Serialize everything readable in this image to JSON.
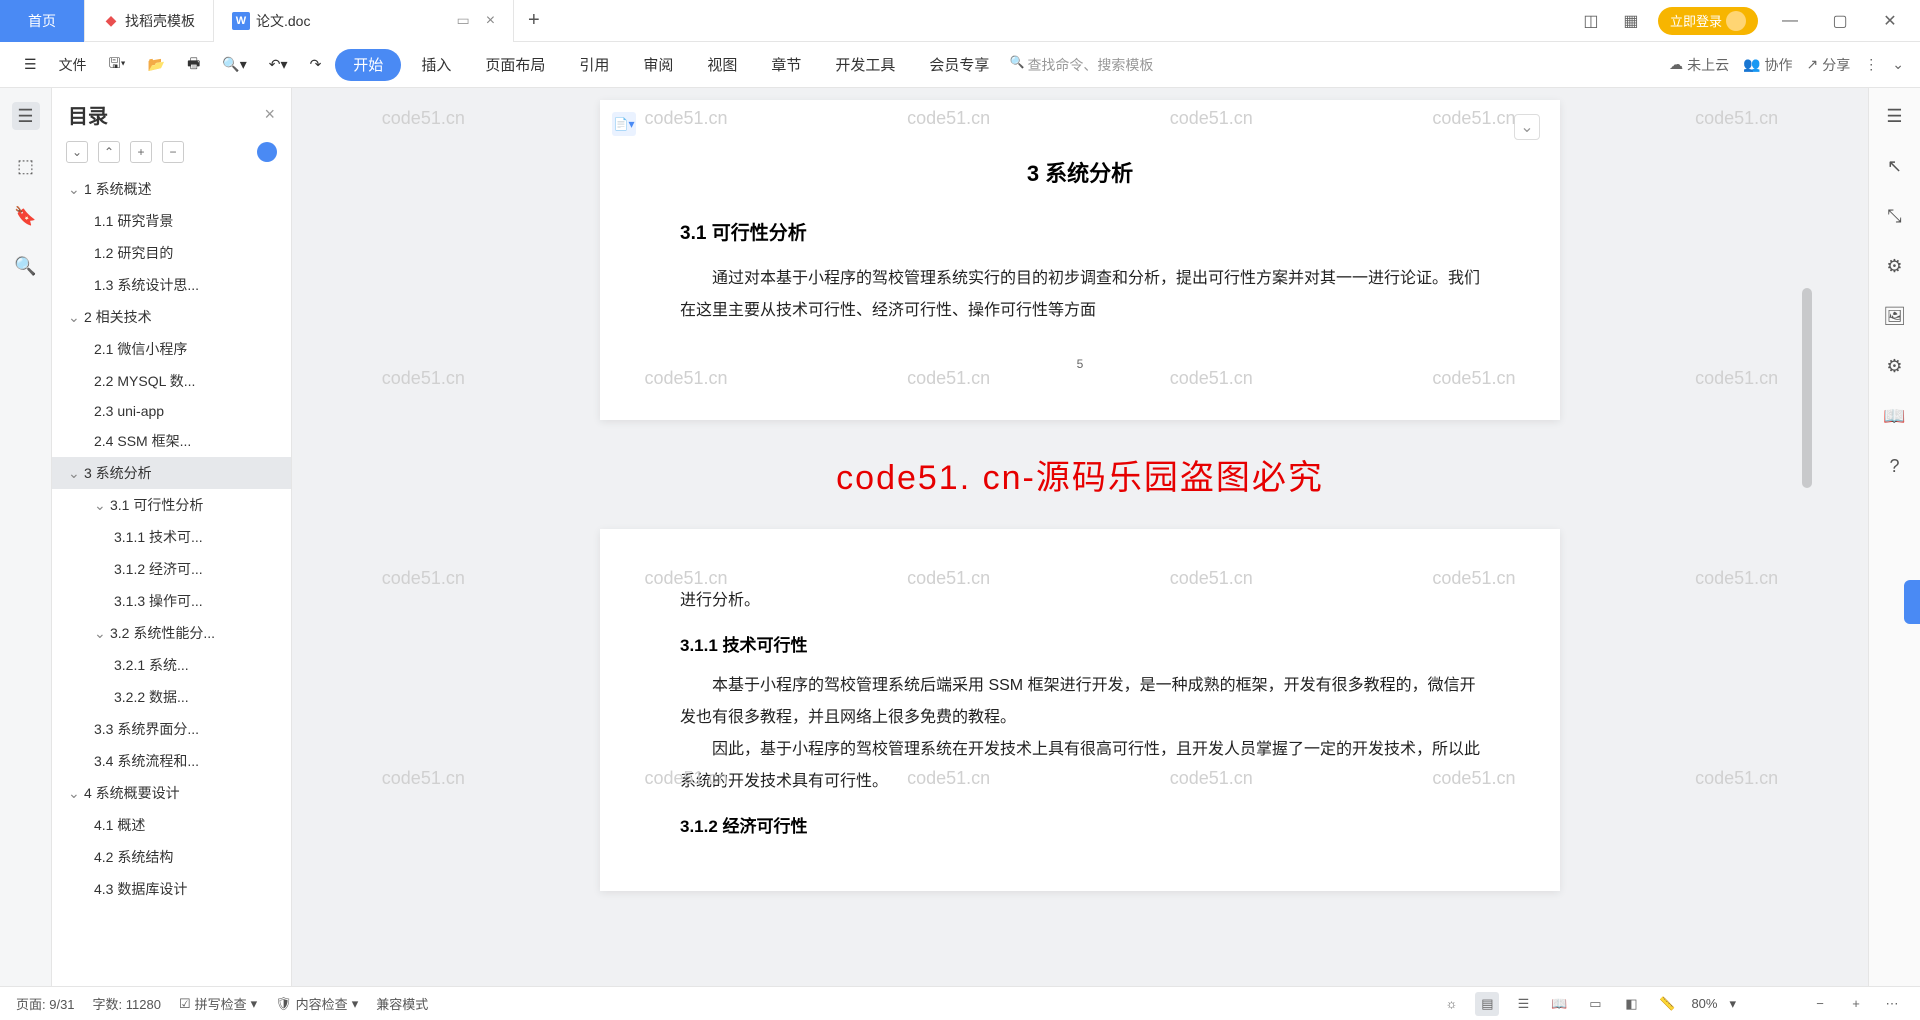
{
  "titlebar": {
    "home_tab": "首页",
    "tab1": {
      "label": "找稻壳模板"
    },
    "tab2": {
      "label": "论文.doc"
    },
    "login": "立即登录"
  },
  "toolbar": {
    "file": "文件",
    "menu": [
      "开始",
      "插入",
      "页面布局",
      "引用",
      "审阅",
      "视图",
      "章节",
      "开发工具",
      "会员专享"
    ],
    "search_placeholder": "查找命令、搜索模板",
    "cloud": "未上云",
    "coop": "协作",
    "share": "分享"
  },
  "outline": {
    "title": "目录",
    "items": [
      {
        "lv": 1,
        "exp": true,
        "label": "1 系统概述"
      },
      {
        "lv": 2,
        "label": "1.1 研究背景"
      },
      {
        "lv": 2,
        "label": "1.2 研究目的"
      },
      {
        "lv": 2,
        "label": "1.3 系统设计思..."
      },
      {
        "lv": 1,
        "exp": true,
        "label": "2 相关技术"
      },
      {
        "lv": 2,
        "label": "2.1 微信小程序"
      },
      {
        "lv": 2,
        "label": "2.2 MYSQL 数..."
      },
      {
        "lv": 2,
        "label": "2.3 uni-app"
      },
      {
        "lv": 2,
        "label": "2.4 SSM 框架..."
      },
      {
        "lv": 1,
        "exp": true,
        "label": "3 系统分析",
        "sel": true
      },
      {
        "lv": 2,
        "exp": true,
        "label": "3.1 可行性分析"
      },
      {
        "lv": 3,
        "label": "3.1.1 技术可..."
      },
      {
        "lv": 3,
        "label": "3.1.2 经济可..."
      },
      {
        "lv": 3,
        "label": "3.1.3 操作可..."
      },
      {
        "lv": 2,
        "exp": true,
        "label": "3.2 系统性能分..."
      },
      {
        "lv": 3,
        "label": "3.2.1 系统..."
      },
      {
        "lv": 3,
        "label": "3.2.2 数据..."
      },
      {
        "lv": 2,
        "label": "3.3 系统界面分..."
      },
      {
        "lv": 2,
        "label": "3.4 系统流程和..."
      },
      {
        "lv": 1,
        "exp": true,
        "label": "4 系统概要设计"
      },
      {
        "lv": 2,
        "label": "4.1 概述"
      },
      {
        "lv": 2,
        "label": "4.2 系统结构"
      },
      {
        "lv": 2,
        "label": "4.3 数据库设计"
      }
    ]
  },
  "document": {
    "h2": "3 系统分析",
    "h3_1": "3.1 可行性分析",
    "p1": "通过对本基于小程序的驾校管理系统实行的目的初步调查和分析，提出可行性方案并对其一一进行论证。我们在这里主要从技术可行性、经济可行性、操作可行性等方面",
    "page_num_top": "5",
    "watermark_big": "code51. cn-源码乐园盗图必究",
    "watermark_small": "code51.cn",
    "p2": "进行分析。",
    "h4_1": "3.1.1 技术可行性",
    "p3": "本基于小程序的驾校管理系统后端采用 SSM 框架进行开发，是一种成熟的框架，开发有很多教程的，微信开发也有很多教程，并且网络上很多免费的教程。",
    "p4": "因此，基于小程序的驾校管理系统在开发技术上具有很高可行性，且开发人员掌握了一定的开发技术，所以此系统的开发技术具有可行性。",
    "h4_2": "3.1.2 经济可行性"
  },
  "statusbar": {
    "page": "页面: 9/31",
    "words": "字数: 11280",
    "spellcheck": "拼写检查",
    "contentcheck": "内容检查",
    "compat": "兼容模式",
    "zoom": "80%"
  }
}
